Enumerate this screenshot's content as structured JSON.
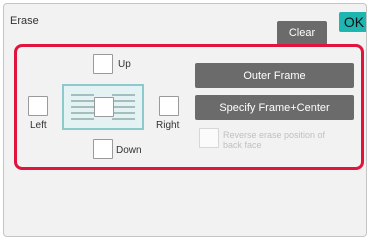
{
  "dialog": {
    "title": "Erase",
    "clear_label": "Clear",
    "ok_label": "OK"
  },
  "positions": {
    "up_label": "Up",
    "down_label": "Down",
    "left_label": "Left",
    "right_label": "Right",
    "up_checked": false,
    "down_checked": false,
    "left_checked": false,
    "right_checked": false,
    "center_checked": false
  },
  "actions": {
    "outer_frame_label": "Outer Frame",
    "specify_frame_center_label": "Specify Frame+Center",
    "reverse_erase_label": "Reverse erase position of back face",
    "reverse_erase_enabled": false
  },
  "colors": {
    "accent_ok": "#1fb5b0",
    "highlight_frame": "#e0143c",
    "button_gray": "#6b6b6b"
  }
}
